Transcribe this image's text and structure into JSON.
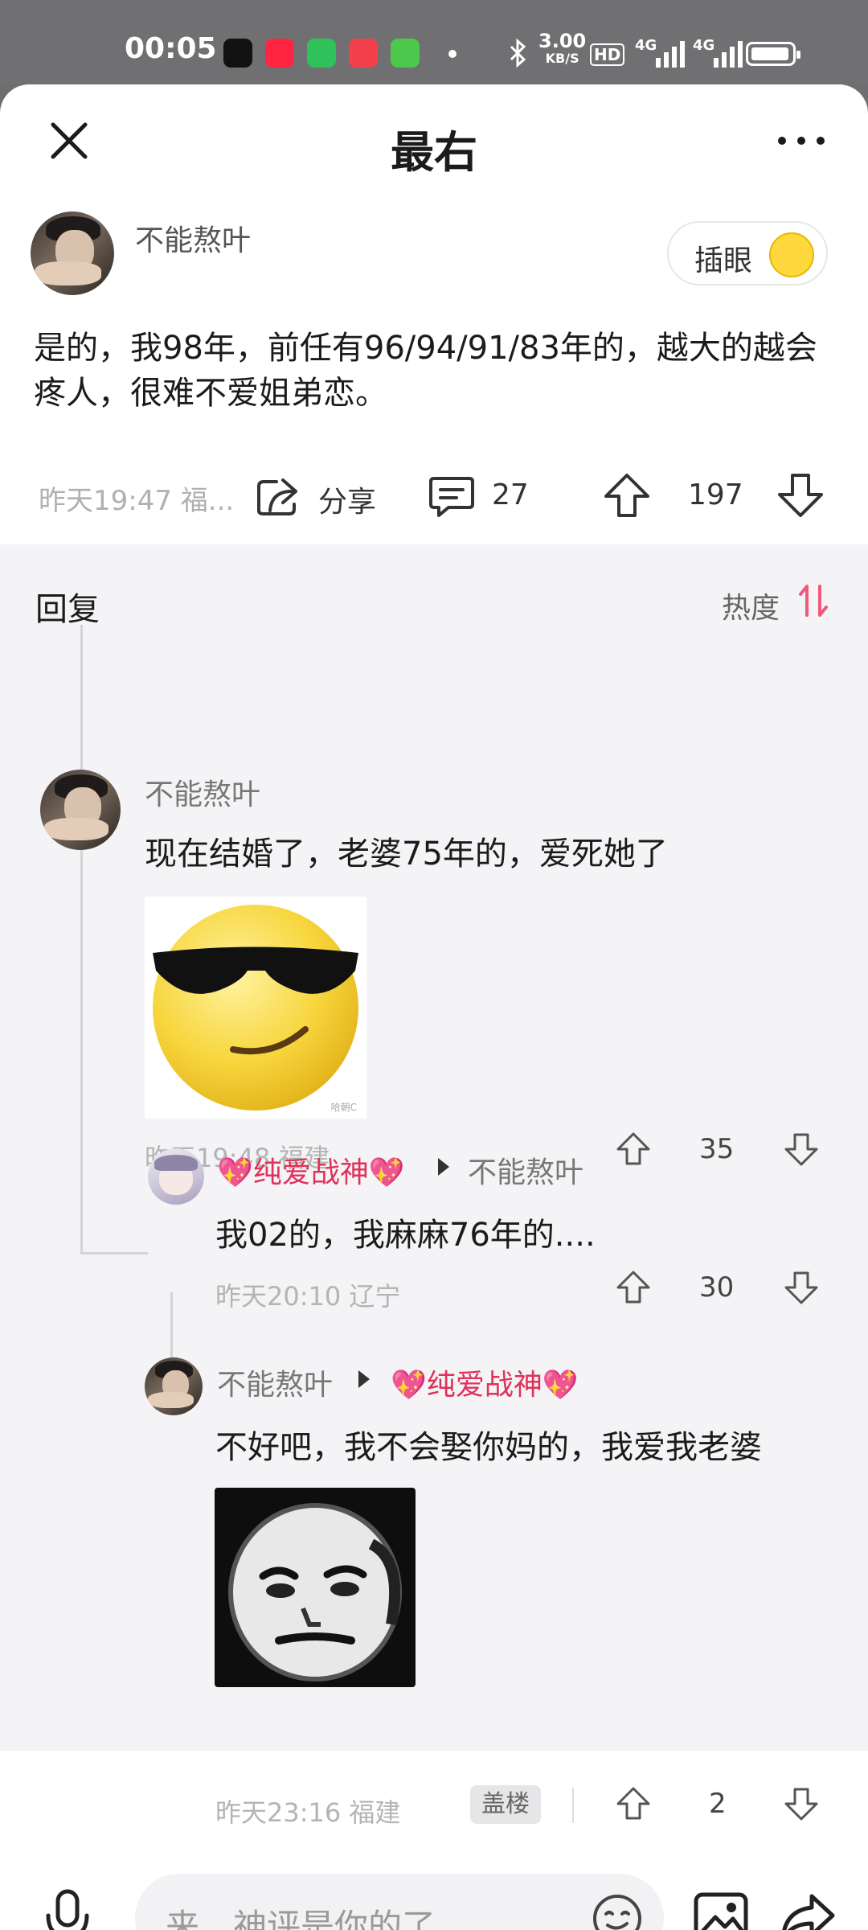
{
  "status_bar": {
    "time": "00:05",
    "network_speed": "3.00",
    "network_unit": "KB/S",
    "hd": "HD",
    "signal1": "4G",
    "signal2": "4G"
  },
  "header": {
    "title": "最右"
  },
  "post": {
    "author": "不能熬叶",
    "poke_label": "插眼",
    "body": "是的，我98年，前任有96/94/91/83年的，越大的越会疼人，很难不爱姐弟恋。",
    "time": "昨天19:47 福...",
    "share_label": "分享",
    "comment_count": "27",
    "upvotes": "197"
  },
  "replies": {
    "title": "回复",
    "sort_label": "热度",
    "comments": [
      {
        "author": "不能熬叶",
        "text": "现在结婚了，老婆75年的，爱死她了",
        "sticker_watermark": "哈朝C",
        "meta": "昨天19:48 福建",
        "upvotes": "35"
      },
      {
        "author": "💖纯爱战神💖",
        "reply_to": "不能熬叶",
        "text": "我02的，我麻麻76年的....",
        "meta": "昨天20:10 辽宁",
        "upvotes": "30"
      },
      {
        "author": "不能熬叶",
        "reply_to": "💖纯爱战神💖",
        "text": "不好吧，我不会娶你妈的，我爱我老婆",
        "meta": "昨天23:16 福建",
        "floor_chip": "盖楼",
        "upvotes": "2"
      }
    ]
  },
  "composer": {
    "placeholder": "来，神评是你的了"
  },
  "colors": {
    "accent": "#f05a78",
    "background": "#f4f4f6"
  }
}
